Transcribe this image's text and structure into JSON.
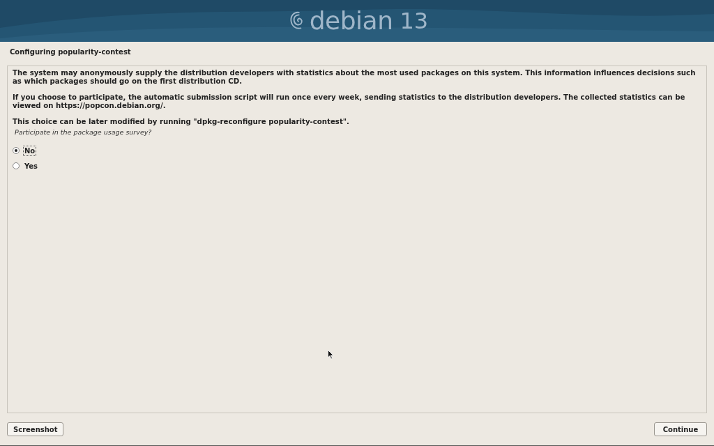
{
  "banner": {
    "logo_text": "debian",
    "version": "13"
  },
  "title": "Configuring popularity-contest",
  "paragraphs": [
    "The system may anonymously supply the distribution developers with statistics about the most used packages on this system. This information influences decisions such as which packages should go on the first distribution CD.",
    "If you choose to participate, the automatic submission script will run once every week, sending statistics to the distribution developers. The collected statistics can be viewed on https://popcon.debian.org/.",
    "This choice can be later modified by running \"dpkg-reconfigure popularity-contest\"."
  ],
  "question": "Participate in the package usage survey?",
  "choices": [
    {
      "label": "No",
      "selected": true,
      "focused": true
    },
    {
      "label": "Yes",
      "selected": false,
      "focused": false
    }
  ],
  "buttons": {
    "left": "Screenshot",
    "right": "Continue"
  }
}
